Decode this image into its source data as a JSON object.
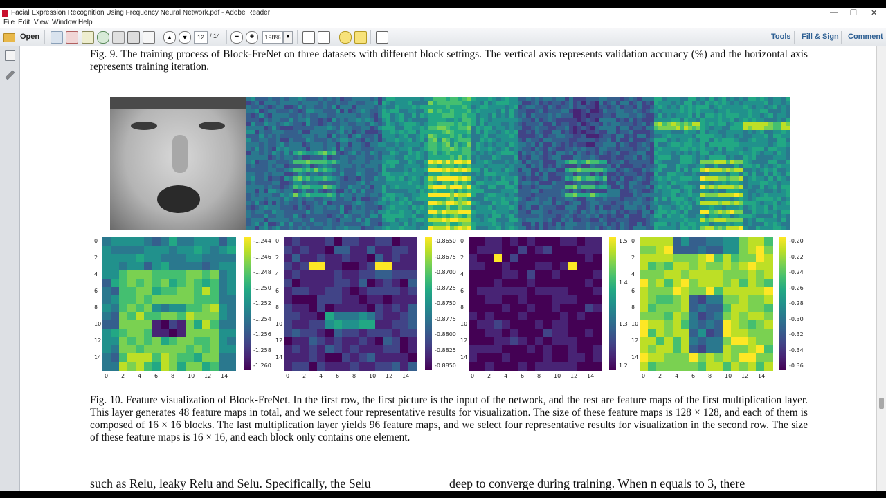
{
  "window": {
    "title": "Facial Expression Recognition Using Frequency Neural Network.pdf - Adobe Reader",
    "minimize": "—",
    "restore": "❐",
    "close": "✕"
  },
  "menu": {
    "file": "File",
    "edit": "Edit",
    "view": "View",
    "window": "Window",
    "help": "Help"
  },
  "toolbar": {
    "open": "Open",
    "page_current": "12",
    "page_total": "/ 14",
    "zoom": "198%",
    "tools": "Tools",
    "fill_sign": "Fill & Sign",
    "comment": "Comment"
  },
  "doc": {
    "fig9_caption": "Fig. 9.   The training process of Block-FreNet on three datasets with different block settings. The vertical axis represents validation accuracy (%) and the horizontal axis represents training iteration.",
    "fig10_caption": "Fig. 10.   Feature visualization of Block-FreNet. In the first row, the first picture is the input of the network, and the rest are feature maps of the first multiplication layer. This layer generates 48 feature maps in total, and we select four representative results for visualization. The size of these feature maps is 128 × 128, and each of them is composed of 16 × 16 blocks. The last multiplication layer yields 96 feature maps, and we select four representative results for visualization in the second row. The size of these feature maps is 16 × 16, and each block only contains one element.",
    "body_left": "such as Relu, leaky Relu and Selu. Specifically, the Selu",
    "body_right": "deep to converge during training. When n equals to 3, there"
  },
  "heatmaps": {
    "axis_ticks": [
      "0",
      "2",
      "4",
      "6",
      "8",
      "10",
      "12",
      "14"
    ],
    "cbar1": [
      "-1.244",
      "-1.246",
      "-1.248",
      "-1.250",
      "-1.252",
      "-1.254",
      "-1.256",
      "-1.258",
      "-1.260"
    ],
    "cbar2": [
      "-0.8650",
      "-0.8675",
      "-0.8700",
      "-0.8725",
      "-0.8750",
      "-0.8775",
      "-0.8800",
      "-0.8825",
      "-0.8850"
    ],
    "cbar3": [
      "1.5",
      "1.4",
      "1.3",
      "1.2"
    ],
    "cbar4": [
      "-0.20",
      "-0.22",
      "-0.24",
      "-0.26",
      "-0.28",
      "-0.30",
      "-0.32",
      "-0.34",
      "-0.36"
    ]
  },
  "colors": {
    "viridis_low": "#440154",
    "viridis_mid": "#21918c",
    "viridis_high": "#fde725",
    "link": "#2d5f93"
  }
}
